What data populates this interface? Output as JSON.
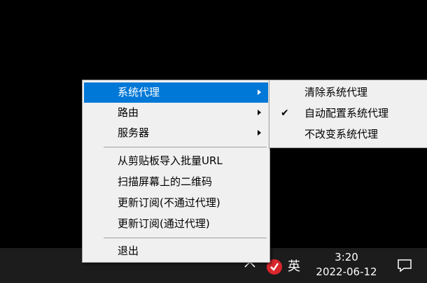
{
  "main_menu": {
    "items": [
      {
        "label": "系统代理",
        "has_submenu": true
      },
      {
        "label": "路由",
        "has_submenu": true
      },
      {
        "label": "服务器",
        "has_submenu": true
      },
      {
        "label": "从剪贴板导入批量URL"
      },
      {
        "label": "扫描屏幕上的二维码"
      },
      {
        "label": "更新订阅(不通过代理)"
      },
      {
        "label": "更新订阅(通过代理)"
      },
      {
        "label": "退出"
      }
    ],
    "highlighted_index": 0
  },
  "sub_menu": {
    "items": [
      {
        "label": "清除系统代理",
        "checked": false
      },
      {
        "label": "自动配置系统代理",
        "checked": true
      },
      {
        "label": "不改变系统代理",
        "checked": false
      }
    ],
    "check_glyph": "✔"
  },
  "taskbar": {
    "language": "英",
    "time": "3:20",
    "date": "2022-06-12",
    "icons": [
      "chevron-up-icon",
      "v2rayn-icon",
      "notification-icon"
    ]
  },
  "colors": {
    "highlight": "#0078d7",
    "menu_bg": "#f0f0f0",
    "taskbar_bg": "#1c1c1c",
    "app_icon": "#d9262c"
  }
}
